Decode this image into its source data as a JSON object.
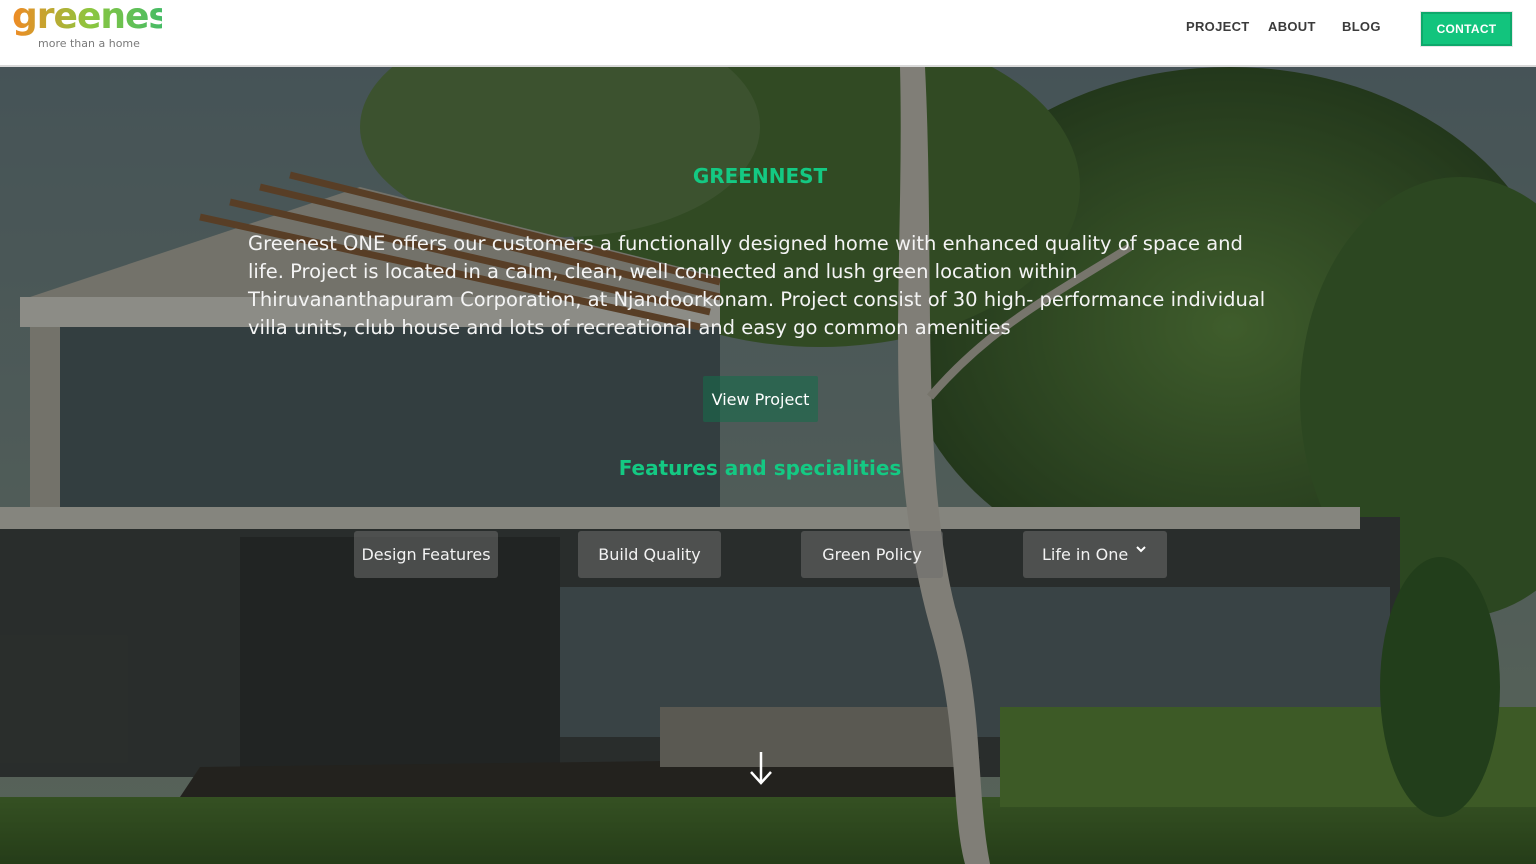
{
  "header": {
    "logo": {
      "wordmark": "greenest",
      "tagline": "more than a home"
    },
    "nav": {
      "project": "PROJECT",
      "about": "ABOUT",
      "blog": "BLOG",
      "contact": "CONTACT"
    }
  },
  "hero": {
    "title": "GREENNEST",
    "description": "Greenest ONE offers our customers a functionally designed home with enhanced quality of space and life. Project is located in a calm, clean, well connected and lush green location within Thiruvananthapuram Corporation, at Njandoorkonam. Project consist of 30 high- performance individual villa units, club house and lots of recreational and easy go common amenities",
    "view_project": "View Project",
    "features_heading": "Features and specialities",
    "feature_buttons": [
      "Design Features",
      "Build Quality",
      "Green Policy",
      "Life in One"
    ],
    "scroll_icon": "arrow-down-icon"
  },
  "colors": {
    "accent_green": "#14c983",
    "contact_bg": "#12c47d",
    "logo_orange": "#f08a24",
    "logo_green": "#2eb872"
  }
}
